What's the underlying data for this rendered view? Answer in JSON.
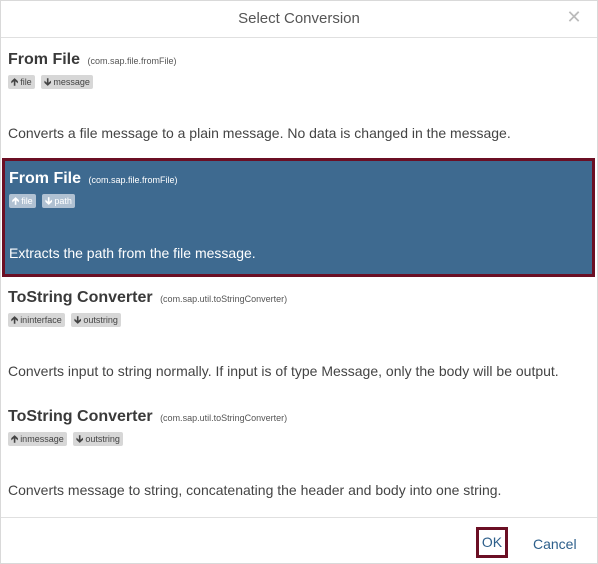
{
  "dialog": {
    "title": "Select Conversion",
    "close_icon": "close-icon"
  },
  "items": [
    {
      "name": "From File",
      "package": "(com.sap.file.fromFile)",
      "badges": [
        {
          "icon": "arrow-up-icon",
          "label": "file"
        },
        {
          "icon": "arrow-down-icon",
          "label": "message"
        }
      ],
      "description": "Converts a file message to a plain message. No data is changed in the message.",
      "selected": false
    },
    {
      "name": "From File",
      "package": "(com.sap.file.fromFile)",
      "badges": [
        {
          "icon": "arrow-up-icon",
          "label": "file"
        },
        {
          "icon": "arrow-down-icon",
          "label": "path"
        }
      ],
      "description": "Extracts the path from the file message.",
      "selected": true
    },
    {
      "name": "ToString Converter",
      "package": "(com.sap.util.toStringConverter)",
      "badges": [
        {
          "icon": "arrow-up-icon",
          "label": "ininterface"
        },
        {
          "icon": "arrow-down-icon",
          "label": "outstring"
        }
      ],
      "description": "Converts input to string normally. If input is of type Message, only the body will be output.",
      "selected": false
    },
    {
      "name": "ToString Converter",
      "package": "(com.sap.util.toStringConverter)",
      "badges": [
        {
          "icon": "arrow-up-icon",
          "label": "inmessage"
        },
        {
          "icon": "arrow-down-icon",
          "label": "outstring"
        }
      ],
      "description": "Converts message to string, concatenating the header and body into one string.",
      "selected": false
    }
  ],
  "footer": {
    "ok_label": "OK",
    "cancel_label": "Cancel"
  },
  "colors": {
    "selected_background": "#3e6a90",
    "highlight_border": "#6b0f24",
    "button_text": "#2d5f8b"
  }
}
